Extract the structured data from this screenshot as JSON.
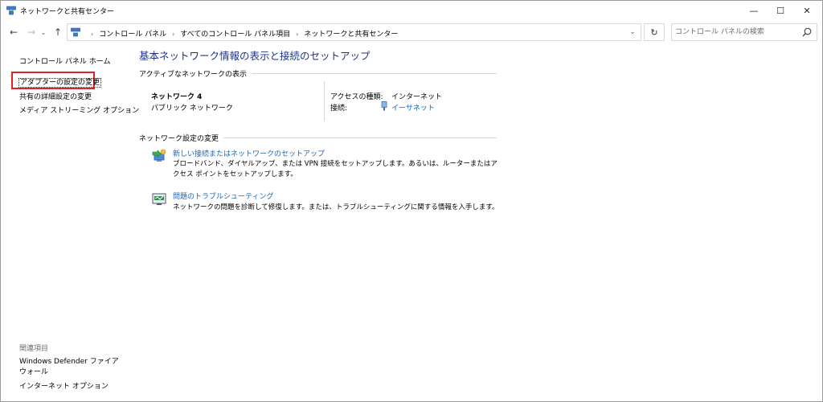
{
  "window": {
    "title": "ネットワークと共有センター",
    "controls": {
      "minimize": "—",
      "maximize": "☐",
      "close": "✕"
    }
  },
  "nav": {
    "back": "←",
    "forward": "→",
    "recent": "⌄",
    "up": "↑",
    "breadcrumbs": [
      "コントロール パネル",
      "すべてのコントロール パネル項目",
      "ネットワークと共有センター"
    ],
    "separator": "›",
    "dropdown": "⌄",
    "refresh": "↻",
    "search_placeholder": "コントロール パネルの検索"
  },
  "sidebar": {
    "home": "コントロール パネル ホーム",
    "links": [
      {
        "label": "アダプターの設定の変更",
        "highlighted": true
      },
      {
        "label": "共有の詳細設定の変更"
      },
      {
        "label": "メディア ストリーミング オプション"
      }
    ],
    "related_heading": "関連項目",
    "related": [
      {
        "label": "Windows Defender ファイアウォール"
      },
      {
        "label": "インターネット オプション"
      }
    ]
  },
  "main": {
    "title": "基本ネットワーク情報の表示と接続のセットアップ",
    "active_section": "アクティブなネットワークの表示",
    "network": {
      "name": "ネットワーク 4",
      "type": "パブリック ネットワーク",
      "access_label": "アクセスの種類:",
      "access_value": "インターネット",
      "connection_label": "接続:",
      "connection_value": "イーサネット"
    },
    "change_section": "ネットワーク設定の変更",
    "tasks": [
      {
        "icon": "new-connection-icon",
        "link": "新しい接続またはネットワークのセットアップ",
        "desc": "ブロードバンド、ダイヤルアップ、または VPN 接続をセットアップします。あるいは、ルーターまたはアクセス ポイントをセットアップします。"
      },
      {
        "icon": "troubleshoot-icon",
        "link": "問題のトラブルシューティング",
        "desc": "ネットワークの問題を診断して修復します。または、トラブルシューティングに関する情報を入手します。"
      }
    ]
  },
  "colors": {
    "title_blue": "#1e3287",
    "link_blue": "#1e64b4",
    "highlight_red": "#e0212b"
  }
}
